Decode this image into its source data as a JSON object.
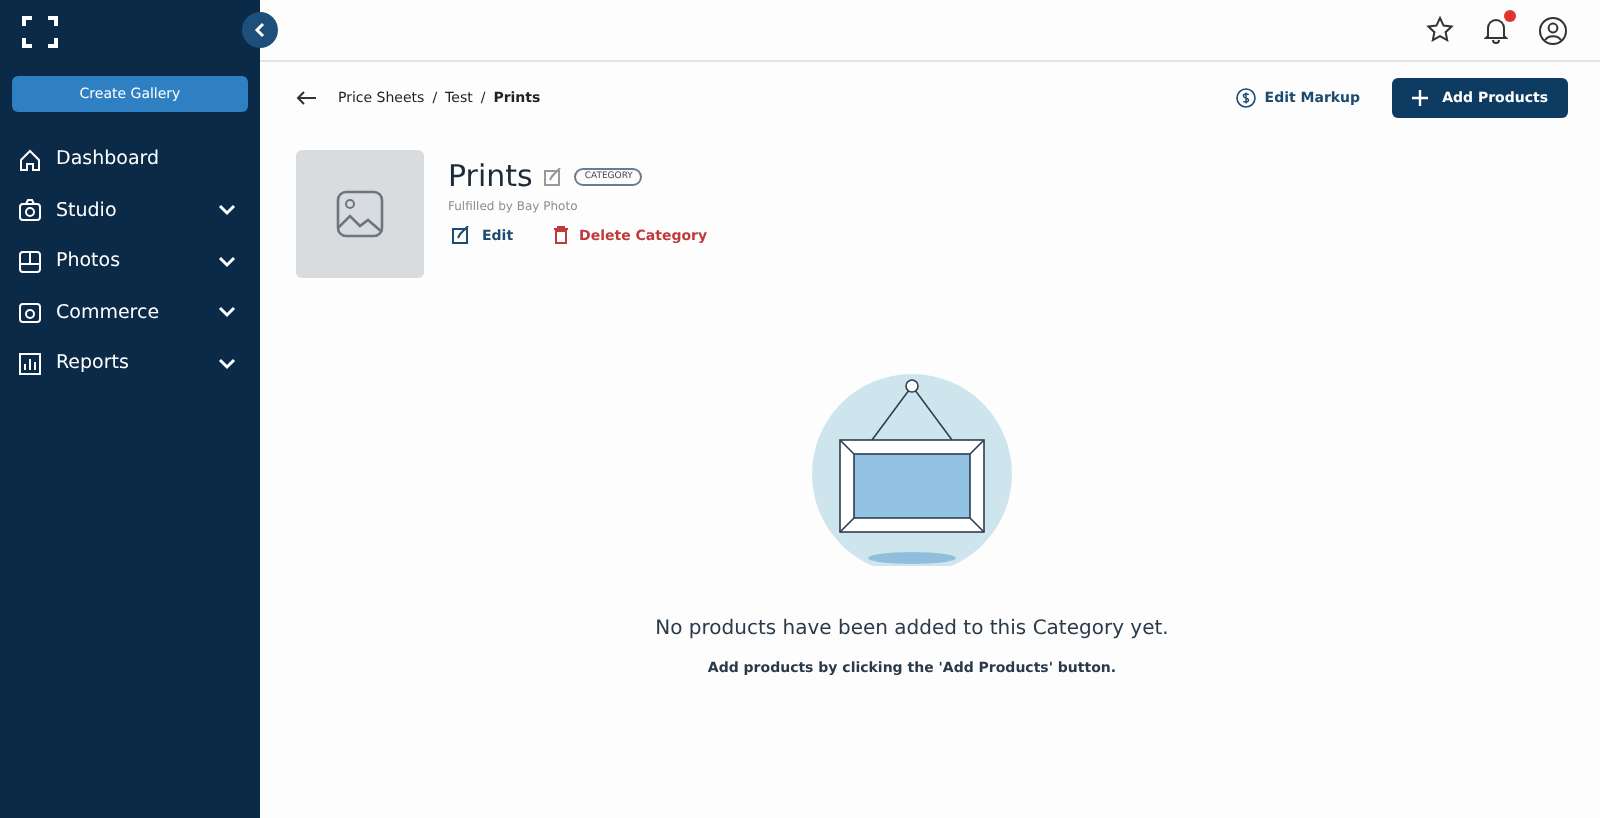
{
  "sidebar": {
    "create_button": "Create Gallery",
    "items": [
      {
        "label": "Dashboard",
        "kind": "link"
      },
      {
        "label": "Studio",
        "kind": "group"
      },
      {
        "label": "Photos",
        "kind": "group"
      },
      {
        "label": "Commerce",
        "kind": "group"
      },
      {
        "label": "Reports",
        "kind": "group"
      }
    ]
  },
  "breadcrumb": {
    "separator": "/",
    "items": [
      {
        "label": "Price Sheets",
        "current": false
      },
      {
        "label": "Test",
        "current": false
      },
      {
        "label": "Prints",
        "current": true
      }
    ]
  },
  "actions": {
    "edit_markup": "Edit Markup",
    "add_products": "Add Products"
  },
  "category": {
    "title": "Prints",
    "badge": "CATEGORY",
    "subtitle": "Fulfilled by Bay Photo",
    "edit": "Edit",
    "delete": "Delete Category"
  },
  "empty_state": {
    "message": "No products have been added to this Category yet.",
    "hint": "Add products by clicking the 'Add Products' button."
  }
}
